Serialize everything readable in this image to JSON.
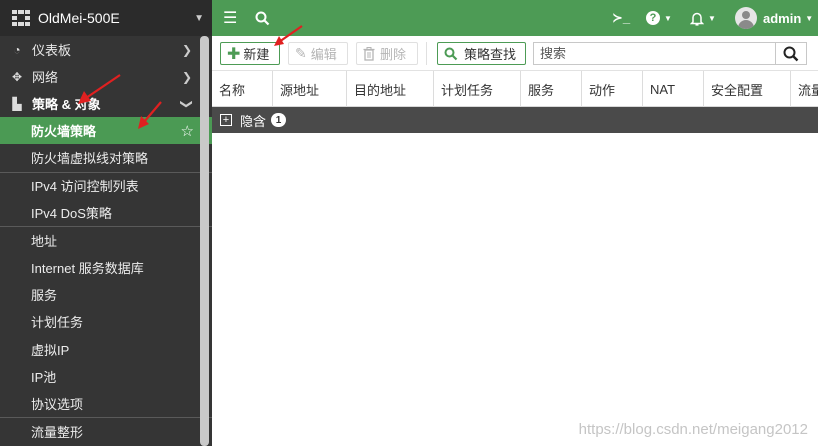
{
  "device": {
    "name": "OldMei-500E"
  },
  "sidebar": {
    "top_items": [
      {
        "label": "仪表板",
        "icon": "dashboard-icon"
      },
      {
        "label": "网络",
        "icon": "network-icon"
      }
    ],
    "section": {
      "label": "策略 & 对象",
      "icon": "policy-icon"
    },
    "sub_items": [
      {
        "label": "防火墙策略",
        "active": true
      },
      {
        "label": "防火墙虚拟线对策略"
      },
      {
        "label": "IPv4 访问控制列表"
      },
      {
        "label": "IPv4 DoS策略"
      },
      {
        "label": "地址"
      },
      {
        "label": "Internet 服务数据库"
      },
      {
        "label": "服务"
      },
      {
        "label": "计划任务"
      },
      {
        "label": "虚拟IP"
      },
      {
        "label": "IP池"
      },
      {
        "label": "协议选项"
      },
      {
        "label": "流量整形"
      }
    ]
  },
  "topbar": {
    "user": "admin"
  },
  "toolbar": {
    "new_label": "新建",
    "edit_label": "编辑",
    "delete_label": "删除",
    "policy_lookup_label": "策略查找",
    "search_placeholder": "搜索"
  },
  "table": {
    "columns": [
      "名称",
      "源地址",
      "目的地址",
      "计划任务",
      "服务",
      "动作",
      "NAT",
      "安全配置",
      "流量"
    ],
    "group": {
      "label": "隐含",
      "count": "1"
    }
  },
  "watermark": "https://blog.csdn.net/meigang2012",
  "colors": {
    "accent": "#4d9b55",
    "sidebar_bg": "#353535",
    "group_bg": "#4a4a4a",
    "annotation": "#e02020"
  }
}
